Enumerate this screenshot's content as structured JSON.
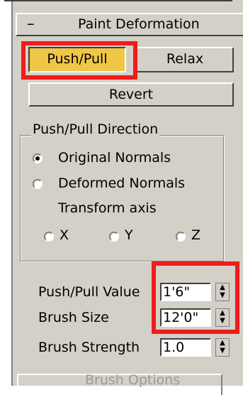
{
  "rollout": {
    "title": "Paint Deformation",
    "collapse_symbol": "–"
  },
  "buttons": {
    "push_pull": "Push/Pull",
    "relax": "Relax",
    "revert": "Revert"
  },
  "direction_group": {
    "title": "Push/Pull Direction",
    "original_normals": "Original Normals",
    "deformed_normals": "Deformed Normals",
    "transform_axis": "Transform axis",
    "axis_x": "X",
    "axis_y": "Y",
    "axis_z": "Z",
    "selected": "original_normals"
  },
  "fields": {
    "push_pull_value": {
      "label": "Push/Pull Value",
      "value": "1'6\""
    },
    "brush_size": {
      "label": "Brush Size",
      "value": "12'0\""
    },
    "brush_strength": {
      "label": "Brush Strength",
      "value": "1.0"
    }
  },
  "brush_options": "Brush Options",
  "colors": {
    "panel": "#d4d0c8",
    "active": "#f0c646",
    "highlight_box": "#ee1c1c"
  }
}
